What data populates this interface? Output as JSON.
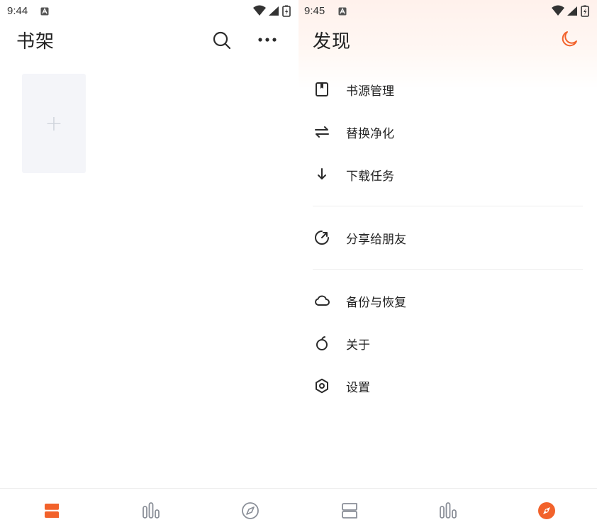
{
  "colors": {
    "accent": "#f2622b",
    "icon_gray": "#8a8f98",
    "icon_dark": "#2b2b2b",
    "text": "#222222"
  },
  "left_panel": {
    "status_time": "9:44",
    "title": "书架",
    "icons": [
      "search-icon",
      "more-icon"
    ],
    "add_tile_symbol": "+"
  },
  "right_panel": {
    "status_time": "9:45",
    "title": "发现",
    "theme_icon": "moon-icon",
    "menu": [
      {
        "icon": "book-source-icon",
        "label": "书源管理"
      },
      {
        "icon": "swap-icon",
        "label": "替换净化"
      },
      {
        "icon": "download-icon",
        "label": "下载任务"
      },
      {
        "icon": "share-icon",
        "label": "分享给朋友"
      },
      {
        "icon": "cloud-icon",
        "label": "备份与恢复"
      },
      {
        "icon": "about-icon",
        "label": "关于"
      },
      {
        "icon": "settings-icon",
        "label": "设置"
      }
    ]
  },
  "bottom_nav": {
    "left_items": [
      "bookshelf-icon",
      "chart-icon",
      "compass-icon"
    ],
    "right_items": [
      "bookshelf-icon",
      "chart-icon",
      "compass-icon"
    ],
    "active_left": 0,
    "active_right": 2
  }
}
